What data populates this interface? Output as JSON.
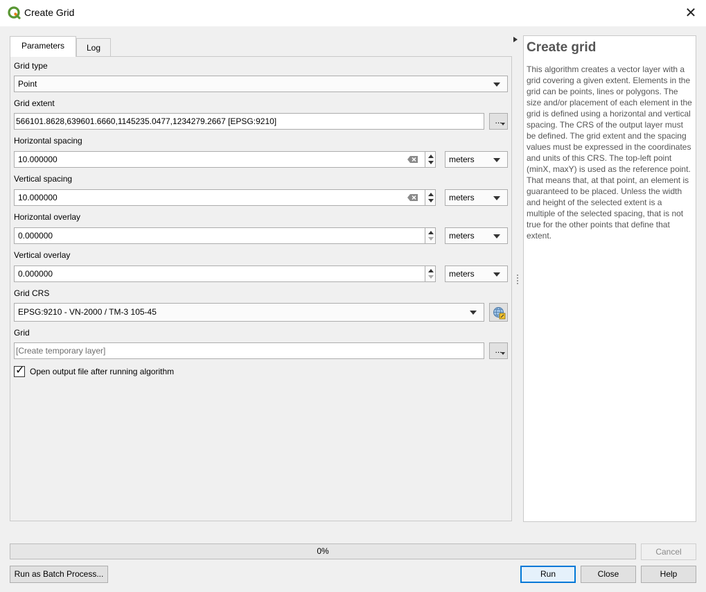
{
  "window": {
    "title": "Create Grid",
    "close_glyph": "✕",
    "app_icon": "qgis-logo-icon"
  },
  "tabs": [
    {
      "label": "Parameters",
      "active": true
    },
    {
      "label": "Log",
      "active": false
    }
  ],
  "params": {
    "grid_type": {
      "label": "Grid type",
      "value": "Point"
    },
    "grid_extent": {
      "label": "Grid extent",
      "value": "566101.8628,639601.6660,1145235.0477,1234279.2667 [EPSG:9210]",
      "button": "..."
    },
    "horizontal_spacing": {
      "label": "Horizontal spacing",
      "value": "10.000000",
      "unit": "meters"
    },
    "vertical_spacing": {
      "label": "Vertical spacing",
      "value": "10.000000",
      "unit": "meters"
    },
    "horizontal_overlay": {
      "label": "Horizontal overlay",
      "value": "0.000000",
      "unit": "meters"
    },
    "vertical_overlay": {
      "label": "Vertical overlay",
      "value": "0.000000",
      "unit": "meters"
    },
    "grid_crs": {
      "label": "Grid CRS",
      "value": "EPSG:9210 - VN-2000 / TM-3 105-45"
    },
    "grid_output": {
      "label": "Grid",
      "placeholder": "[Create temporary layer]",
      "button": "..."
    },
    "open_output": {
      "label": "Open output file after running algorithm",
      "checked": true
    }
  },
  "help": {
    "title": "Create grid",
    "text": "This algorithm creates a vector layer with a grid covering a given extent. Elements in the grid can be points, lines or polygons. The size and/or placement of each element in the grid is defined using a horizontal and vertical spacing. The CRS of the output layer must be defined. The grid extent and the spacing values must be expressed in the coordinates and units of this CRS. The top-left point (minX, maxY) is used as the reference point. That means that, at that point, an element is guaranteed to be placed. Unless the width and height of the selected extent is a multiple of the selected spacing, that is not true for the other points that define that extent."
  },
  "progress": {
    "value": 0,
    "label": "0%"
  },
  "buttons": {
    "cancel": "Cancel",
    "batch": "Run as Batch Process...",
    "run": "Run",
    "close": "Close",
    "help": "Help"
  },
  "colors": {
    "accent": "#0078d7",
    "qgis_green": "#589632",
    "qgis_yellow": "#ee7913"
  }
}
